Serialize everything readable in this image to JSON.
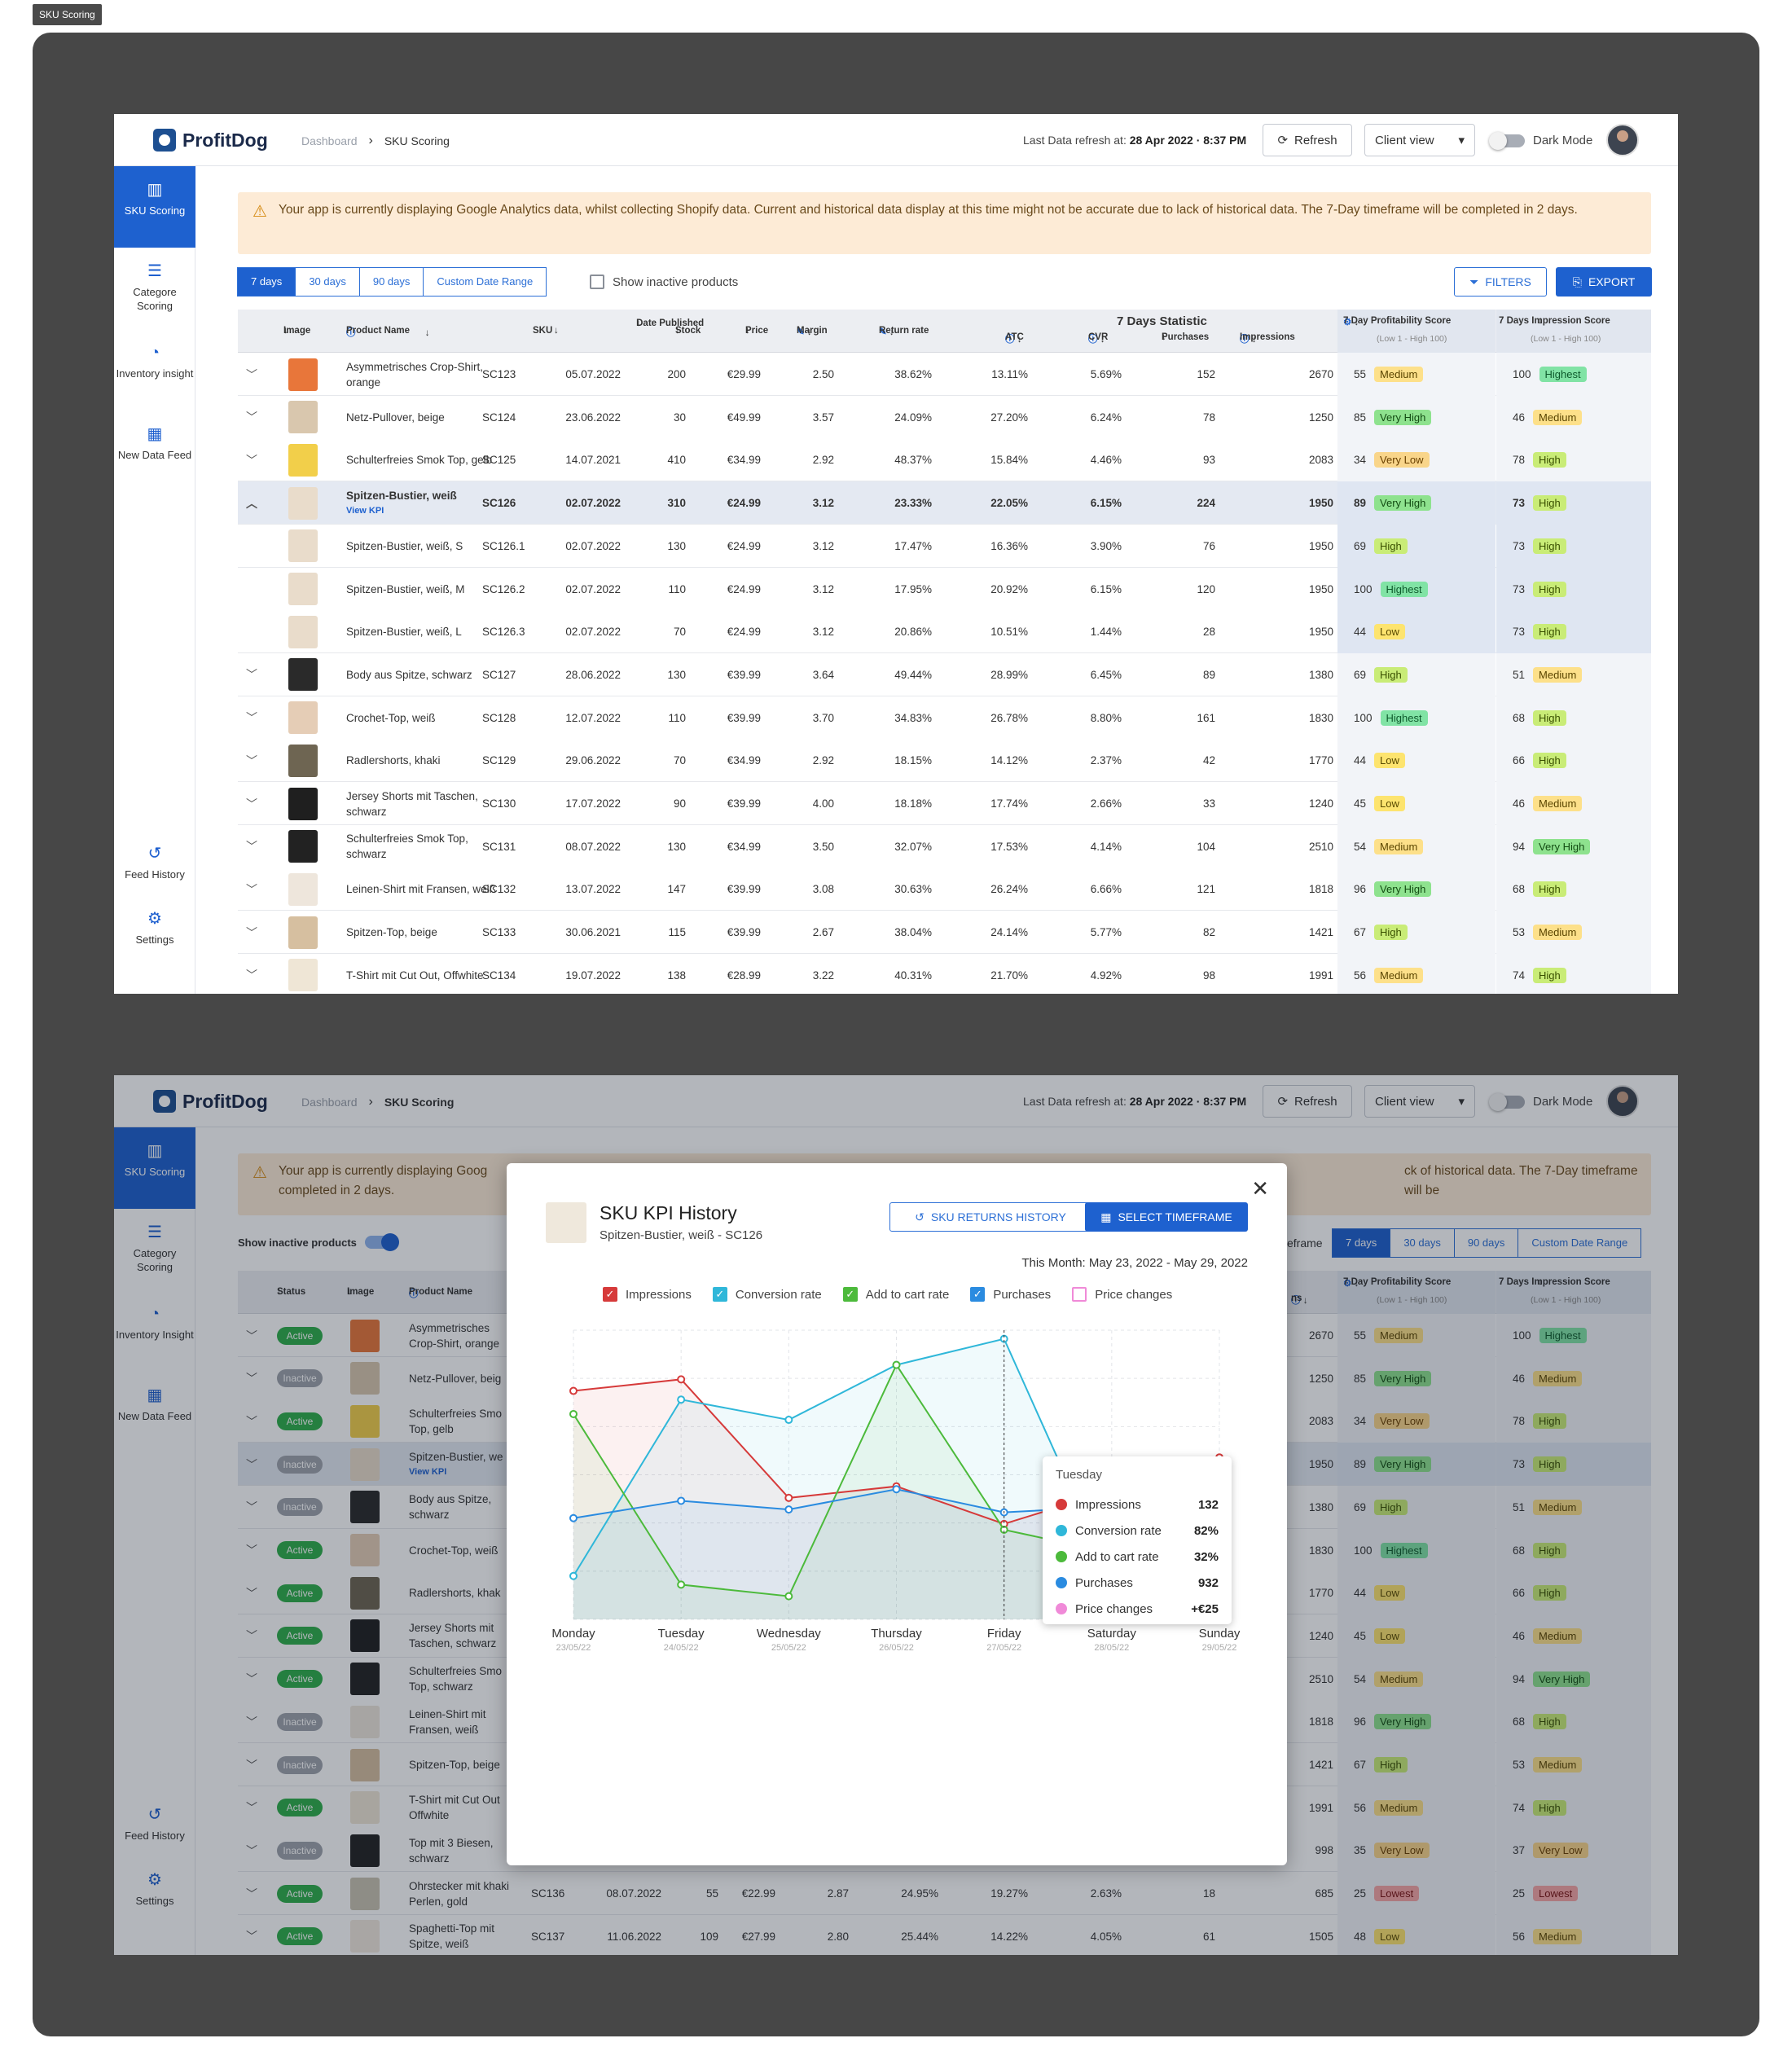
{
  "frame_tag": "SKU Scoring",
  "brand": "ProfitDog",
  "breadcrumb": {
    "home": "Dashboard",
    "current": "SKU Scoring"
  },
  "refresh_info": {
    "label": "Last Data refresh at:",
    "value": "28 Apr 2022 · 8:37 PM"
  },
  "refresh_label": "Refresh",
  "client_view_label": "Client view",
  "dark_mode_label": "Dark Mode",
  "nav": {
    "sku": "SKU Scoring",
    "category": "Categore Scoring",
    "category2": "Category Scoring",
    "inventory": "Inventory insight",
    "inventory2": "Inventory Insight",
    "feed": "New Data Feed",
    "history": "Feed History",
    "settings": "Settings"
  },
  "warning": "Your app is currently displaying Google Analytics data, whilst collecting Shopify data. Current and historical data display at this time might not be accurate due to lack of historical data. The 7-Day timeframe will be completed in 2 days.",
  "warning_part": "Your app is currently displaying Goog",
  "warning_tail": "ck of historical data. The 7-Day timeframe will be",
  "warning_line2": "completed in 2 days.",
  "ranges": [
    "7 days",
    "30 days",
    "90 days",
    "Custom Date Range"
  ],
  "show_inactive_label": "Show inactive products",
  "filters_label": "FILTERS",
  "export_label": "EXPORT",
  "columns": {
    "image": "Image",
    "product": "Product Name",
    "sku": "SKU",
    "date": "Date Published",
    "stock": "Stock",
    "price": "Price",
    "margin": "Margin",
    "return": "Return rate",
    "stat_group": "7 Days Statistic",
    "atc": "ATC",
    "cvr": "CVR",
    "purchases": "Purchases",
    "impressions": "Impressions",
    "profit": "7 Day Profitability Score",
    "profit_sub": "(Low 1 - High 100)",
    "imp_score": "7 Days Impression Score",
    "imp_sub": "(Low 1 - High 100)",
    "status": "Status",
    "frame_tail": "eframe",
    "ns": "ns"
  },
  "view_kpi": "View KPI",
  "rows": [
    {
      "name": "Asymmetrisches Crop-Shirt, orange",
      "sku": "SC123",
      "date": "05.07.2022",
      "stock": "200",
      "price": "€29.99",
      "margin": "2.50",
      "ret": "38.62%",
      "atc": "13.11%",
      "cvr": "5.69%",
      "pur": "152",
      "imp": "2670",
      "ps": "55",
      "pl": "Medium",
      "is": "100",
      "il": "Highest",
      "color": "#e8763a",
      "status": "Active"
    },
    {
      "name": "Netz-Pullover, beige",
      "sku": "SC124",
      "date": "23.06.2022",
      "stock": "30",
      "price": "€49.99",
      "margin": "3.57",
      "ret": "24.09%",
      "atc": "27.20%",
      "cvr": "6.24%",
      "pur": "78",
      "imp": "1250",
      "ps": "85",
      "pl": "Very High",
      "is": "46",
      "il": "Medium",
      "color": "#d9c7ae",
      "status": "Inactive"
    },
    {
      "name": "Schulterfreies Smok Top, gelb",
      "sku": "SC125",
      "date": "14.07.2021",
      "stock": "410",
      "price": "€34.99",
      "margin": "2.92",
      "ret": "48.37%",
      "atc": "15.84%",
      "cvr": "4.46%",
      "pur": "93",
      "imp": "2083",
      "ps": "34",
      "pl": "Very Low",
      "is": "78",
      "il": "High",
      "color": "#f2cf4a",
      "status": "Active"
    },
    {
      "name": "Spitzen-Bustier, weiß",
      "sku": "SC126",
      "date": "02.07.2022",
      "stock": "310",
      "price": "€24.99",
      "margin": "3.12",
      "ret": "23.33%",
      "atc": "22.05%",
      "cvr": "6.15%",
      "pur": "224",
      "imp": "1950",
      "ps": "89",
      "pl": "Very High",
      "is": "73",
      "il": "High",
      "color": "#e9dccb",
      "status": "Inactive"
    },
    {
      "name": "Spitzen-Bustier, weiß, S",
      "sku": "SC126.1",
      "date": "02.07.2022",
      "stock": "130",
      "price": "€24.99",
      "margin": "3.12",
      "ret": "17.47%",
      "atc": "16.36%",
      "cvr": "3.90%",
      "pur": "76",
      "imp": "1950",
      "ps": "69",
      "pl": "High",
      "is": "73",
      "il": "High",
      "color": "#e9dccb"
    },
    {
      "name": "Spitzen-Bustier, weiß, M",
      "sku": "SC126.2",
      "date": "02.07.2022",
      "stock": "110",
      "price": "€24.99",
      "margin": "3.12",
      "ret": "17.95%",
      "atc": "20.92%",
      "cvr": "6.15%",
      "pur": "120",
      "imp": "1950",
      "ps": "100",
      "pl": "Highest",
      "is": "73",
      "il": "High",
      "color": "#e9dccb"
    },
    {
      "name": "Spitzen-Bustier, weiß, L",
      "sku": "SC126.3",
      "date": "02.07.2022",
      "stock": "70",
      "price": "€24.99",
      "margin": "3.12",
      "ret": "20.86%",
      "atc": "10.51%",
      "cvr": "1.44%",
      "pur": "28",
      "imp": "1950",
      "ps": "44",
      "pl": "Low",
      "is": "73",
      "il": "High",
      "color": "#e9dccb"
    },
    {
      "name": "Body aus Spitze, schwarz",
      "sku": "SC127",
      "date": "28.06.2022",
      "stock": "130",
      "price": "€39.99",
      "margin": "3.64",
      "ret": "49.44%",
      "atc": "28.99%",
      "cvr": "6.45%",
      "pur": "89",
      "imp": "1380",
      "ps": "69",
      "pl": "High",
      "is": "51",
      "il": "Medium",
      "color": "#2a2a2a",
      "status": "Inactive"
    },
    {
      "name": "Crochet-Top, weiß",
      "sku": "SC128",
      "date": "12.07.2022",
      "stock": "110",
      "price": "€39.99",
      "margin": "3.70",
      "ret": "34.83%",
      "atc": "26.78%",
      "cvr": "8.80%",
      "pur": "161",
      "imp": "1830",
      "ps": "100",
      "pl": "Highest",
      "is": "68",
      "il": "High",
      "color": "#e5cdb6",
      "status": "Active"
    },
    {
      "name": "Radlershorts, khaki",
      "sku": "SC129",
      "date": "29.06.2022",
      "stock": "70",
      "price": "€34.99",
      "margin": "2.92",
      "ret": "18.15%",
      "atc": "14.12%",
      "cvr": "2.37%",
      "pur": "42",
      "imp": "1770",
      "ps": "44",
      "pl": "Low",
      "is": "66",
      "il": "High",
      "color": "#6e6552",
      "status": "Active"
    },
    {
      "name": "Jersey Shorts mit Taschen, schwarz",
      "sku": "SC130",
      "date": "17.07.2022",
      "stock": "90",
      "price": "€39.99",
      "margin": "4.00",
      "ret": "18.18%",
      "atc": "17.74%",
      "cvr": "2.66%",
      "pur": "33",
      "imp": "1240",
      "ps": "45",
      "pl": "Low",
      "is": "46",
      "il": "Medium",
      "color": "#1f1f1f",
      "status": "Active"
    },
    {
      "name": "Schulterfreies Smok Top, schwarz",
      "sku": "SC131",
      "date": "08.07.2022",
      "stock": "130",
      "price": "€34.99",
      "margin": "3.50",
      "ret": "32.07%",
      "atc": "17.53%",
      "cvr": "4.14%",
      "pur": "104",
      "imp": "2510",
      "ps": "54",
      "pl": "Medium",
      "is": "94",
      "il": "Very High",
      "color": "#222",
      "status": "Active"
    },
    {
      "name": "Leinen-Shirt mit Fransen, weiß",
      "sku": "SC132",
      "date": "13.07.2022",
      "stock": "147",
      "price": "€39.99",
      "margin": "3.08",
      "ret": "30.63%",
      "atc": "26.24%",
      "cvr": "6.66%",
      "pur": "121",
      "imp": "1818",
      "ps": "96",
      "pl": "Very High",
      "is": "68",
      "il": "High",
      "color": "#eee6dc",
      "status": "Inactive"
    },
    {
      "name": "Spitzen-Top, beige",
      "sku": "SC133",
      "date": "30.06.2021",
      "stock": "115",
      "price": "€39.99",
      "margin": "2.67",
      "ret": "38.04%",
      "atc": "24.14%",
      "cvr": "5.77%",
      "pur": "82",
      "imp": "1421",
      "ps": "67",
      "pl": "High",
      "is": "53",
      "il": "Medium",
      "color": "#d6bfa0",
      "status": "Inactive"
    },
    {
      "name": "T-Shirt mit Cut Out, Offwhite",
      "sku": "SC134",
      "date": "19.07.2022",
      "stock": "138",
      "price": "€28.99",
      "margin": "3.22",
      "ret": "40.31%",
      "atc": "21.70%",
      "cvr": "4.92%",
      "pur": "98",
      "imp": "1991",
      "ps": "56",
      "pl": "Medium",
      "is": "74",
      "il": "High",
      "color": "#efe6d6",
      "status": "Active"
    }
  ],
  "rows2": [
    {
      "name": "Asymmetrisches Crop-Shirt, orange",
      "status": "Active",
      "imp": "2670",
      "ps": "55",
      "pl": "Medium",
      "is": "100",
      "il": "Highest",
      "color": "#e8763a"
    },
    {
      "name": "Netz-Pullover, beig",
      "status": "Inactive",
      "imp": "1250",
      "ps": "85",
      "pl": "Very High",
      "is": "46",
      "il": "Medium",
      "color": "#d9c7ae"
    },
    {
      "name": "Schulterfreies Smo Top, gelb",
      "status": "Active",
      "imp": "2083",
      "ps": "34",
      "pl": "Very Low",
      "is": "78",
      "il": "High",
      "color": "#f2cf4a"
    },
    {
      "name": "Spitzen-Bustier, we",
      "status": "Inactive",
      "imp": "1950",
      "ps": "89",
      "pl": "Very High",
      "is": "73",
      "il": "High",
      "color": "#e9dccb",
      "kpi": true
    },
    {
      "name": "Body aus Spitze, schwarz",
      "status": "Inactive",
      "imp": "1380",
      "ps": "69",
      "pl": "High",
      "is": "51",
      "il": "Medium",
      "color": "#2a2a2a"
    },
    {
      "name": "Crochet-Top, weiß",
      "status": "Active",
      "imp": "1830",
      "ps": "100",
      "pl": "Highest",
      "is": "68",
      "il": "High",
      "color": "#e5cdb6"
    },
    {
      "name": "Radlershorts, khak",
      "status": "Active",
      "imp": "1770",
      "ps": "44",
      "pl": "Low",
      "is": "66",
      "il": "High",
      "color": "#6e6552"
    },
    {
      "name": "Jersey Shorts mit Taschen, schwarz",
      "status": "Active",
      "imp": "1240",
      "ps": "45",
      "pl": "Low",
      "is": "46",
      "il": "Medium",
      "color": "#1f1f1f"
    },
    {
      "name": "Schulterfreies Smo Top, schwarz",
      "status": "Active",
      "imp": "2510",
      "ps": "54",
      "pl": "Medium",
      "is": "94",
      "il": "Very High",
      "color": "#222"
    },
    {
      "name": "Leinen-Shirt mit Fransen, weiß",
      "status": "Inactive",
      "imp": "1818",
      "ps": "96",
      "pl": "Very High",
      "is": "68",
      "il": "High",
      "color": "#eee6dc"
    },
    {
      "name": "Spitzen-Top, beige",
      "status": "Inactive",
      "imp": "1421",
      "ps": "67",
      "pl": "High",
      "is": "53",
      "il": "Medium",
      "color": "#d6bfa0"
    },
    {
      "name": "T-Shirt mit Cut Out Offwhite",
      "status": "Active",
      "imp": "1991",
      "ps": "56",
      "pl": "Medium",
      "is": "74",
      "il": "High",
      "color": "#efe6d6"
    },
    {
      "name": "Top mit 3 Biesen, schwarz",
      "status": "Inactive",
      "imp": "998",
      "ps": "35",
      "pl": "Very Low",
      "is": "37",
      "il": "Very Low",
      "color": "#222"
    },
    {
      "name": "Ohrstecker mit khaki Perlen, gold",
      "status": "Active",
      "sku": "SC136",
      "date": "08.07.2022",
      "stock": "55",
      "price": "€22.99",
      "margin": "2.87",
      "ret": "24.95%",
      "atc": "19.27%",
      "cvr": "2.63%",
      "pur": "18",
      "imp": "685",
      "ps": "25",
      "pl": "Lowest",
      "is": "25",
      "il": "Lowest",
      "color": "#c9c3b1"
    },
    {
      "name": "Spaghetti-Top mit Spitze, weiß",
      "status": "Active",
      "sku": "SC137",
      "date": "11.06.2022",
      "stock": "109",
      "price": "€27.99",
      "margin": "2.80",
      "ret": "25.44%",
      "atc": "14.22%",
      "cvr": "4.05%",
      "pur": "61",
      "imp": "1505",
      "ps": "48",
      "pl": "Low",
      "is": "56",
      "il": "Medium",
      "color": "#f0e8de"
    }
  ],
  "modal": {
    "title": "SKU KPI History",
    "subtitle": "Spitzen-Bustier, weiß - SC126",
    "returns_btn": "SKU RETURNS HISTORY",
    "timeframe_btn": "SELECT TIMEFRAME",
    "this_month": "This Month: May 23, 2022 - May 29, 2022",
    "tooltip": {
      "day": "Tuesday",
      "items": [
        {
          "label": "Impressions",
          "value": "132",
          "color": "#d63a3a"
        },
        {
          "label": "Conversion rate",
          "value": "82%",
          "color": "#2fb7d9"
        },
        {
          "label": "Add to cart rate",
          "value": "32%",
          "color": "#4cba3b"
        },
        {
          "label": "Purchases",
          "value": "932",
          "color": "#2a8be0"
        },
        {
          "label": "Price changes",
          "value": "+€25",
          "color": "#f08ad8"
        }
      ]
    }
  },
  "chart_data": {
    "type": "line",
    "title": "SKU KPI History",
    "categories": [
      "Monday",
      "Tuesday",
      "Wednesday",
      "Thursday",
      "Friday",
      "Saturday",
      "Sunday"
    ],
    "dates": [
      "23/05/22",
      "24/05/22",
      "25/05/22",
      "26/05/22",
      "27/05/22",
      "28/05/22",
      "29/05/22"
    ],
    "series": [
      {
        "name": "Impressions",
        "color": "#d63a3a",
        "checked": true,
        "values": [
          0.79,
          0.83,
          0.42,
          0.46,
          0.33,
          null,
          0.56
        ]
      },
      {
        "name": "Conversion rate",
        "color": "#2fb7d9",
        "checked": true,
        "values": [
          0.15,
          0.76,
          0.69,
          0.88,
          0.97,
          0.14,
          0.53
        ]
      },
      {
        "name": "Add to cart rate",
        "color": "#4cba3b",
        "checked": true,
        "values": [
          0.71,
          0.12,
          0.08,
          0.88,
          0.31,
          null,
          0.15
        ]
      },
      {
        "name": "Purchases",
        "color": "#2a8be0",
        "checked": true,
        "values": [
          0.35,
          0.41,
          0.38,
          0.45,
          0.37,
          null,
          0.41
        ]
      },
      {
        "name": "Price changes",
        "color": "#f08ad8",
        "checked": false,
        "values": []
      }
    ],
    "highlight": "Friday",
    "grid": true,
    "legend": "top"
  }
}
